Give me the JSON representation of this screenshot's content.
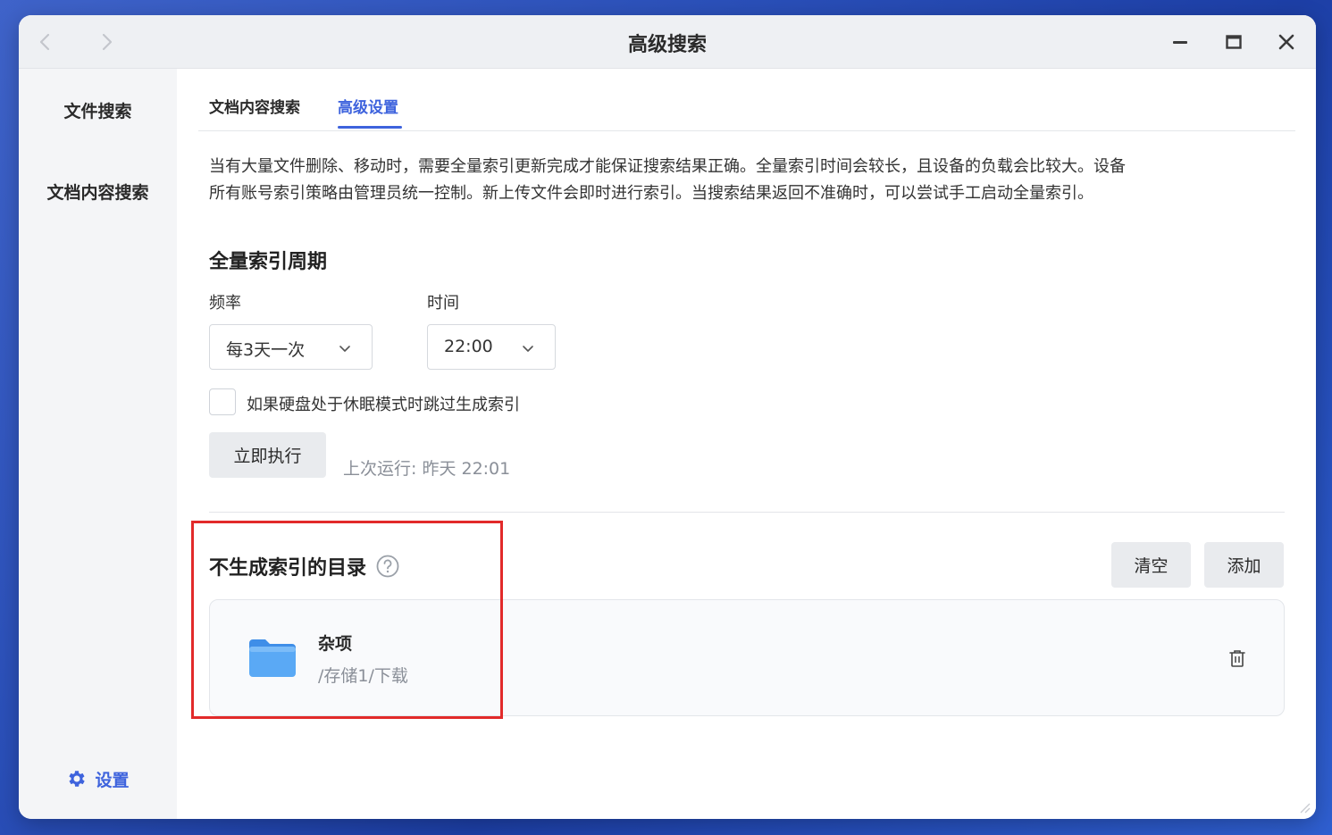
{
  "window": {
    "title": "高级搜索"
  },
  "sidebar": {
    "items": [
      {
        "label": "文件搜索"
      },
      {
        "label": "文档内容搜索"
      }
    ],
    "footer": {
      "label": "设置",
      "icon": "gear-icon"
    }
  },
  "tabs": [
    {
      "label": "文档内容搜索",
      "active": false
    },
    {
      "label": "高级设置",
      "active": true
    }
  ],
  "description": [
    "当有大量文件删除、移动时，需要全量索引更新完成才能保证搜索结果正确。全量索引时间会较长，且设备的负载会比较大。设备",
    "所有账号索引策略由管理员统一控制。新上传文件会即时进行索引。当搜索结果返回不准确时，可以尝试手工启动全量索引。"
  ],
  "full_index": {
    "heading": "全量索引周期",
    "frequency": {
      "label": "频率",
      "value": "每3天一次"
    },
    "time": {
      "label": "时间",
      "value": "22:00"
    },
    "skip_sleep": {
      "label": "如果硬盘处于休眠模式时跳过生成索引",
      "checked": false
    },
    "run_now_label": "立即执行",
    "last_run": "上次运行: 昨天 22:01"
  },
  "excluded": {
    "heading": "不生成索引的目录",
    "clear_label": "清空",
    "add_label": "添加",
    "items": [
      {
        "name": "杂项",
        "path": "/存储1/下载",
        "icon": "folder-icon"
      }
    ]
  },
  "colors": {
    "accent": "#3e63dd",
    "highlight": "#e22a2a",
    "folder": "#5aa9f5"
  }
}
